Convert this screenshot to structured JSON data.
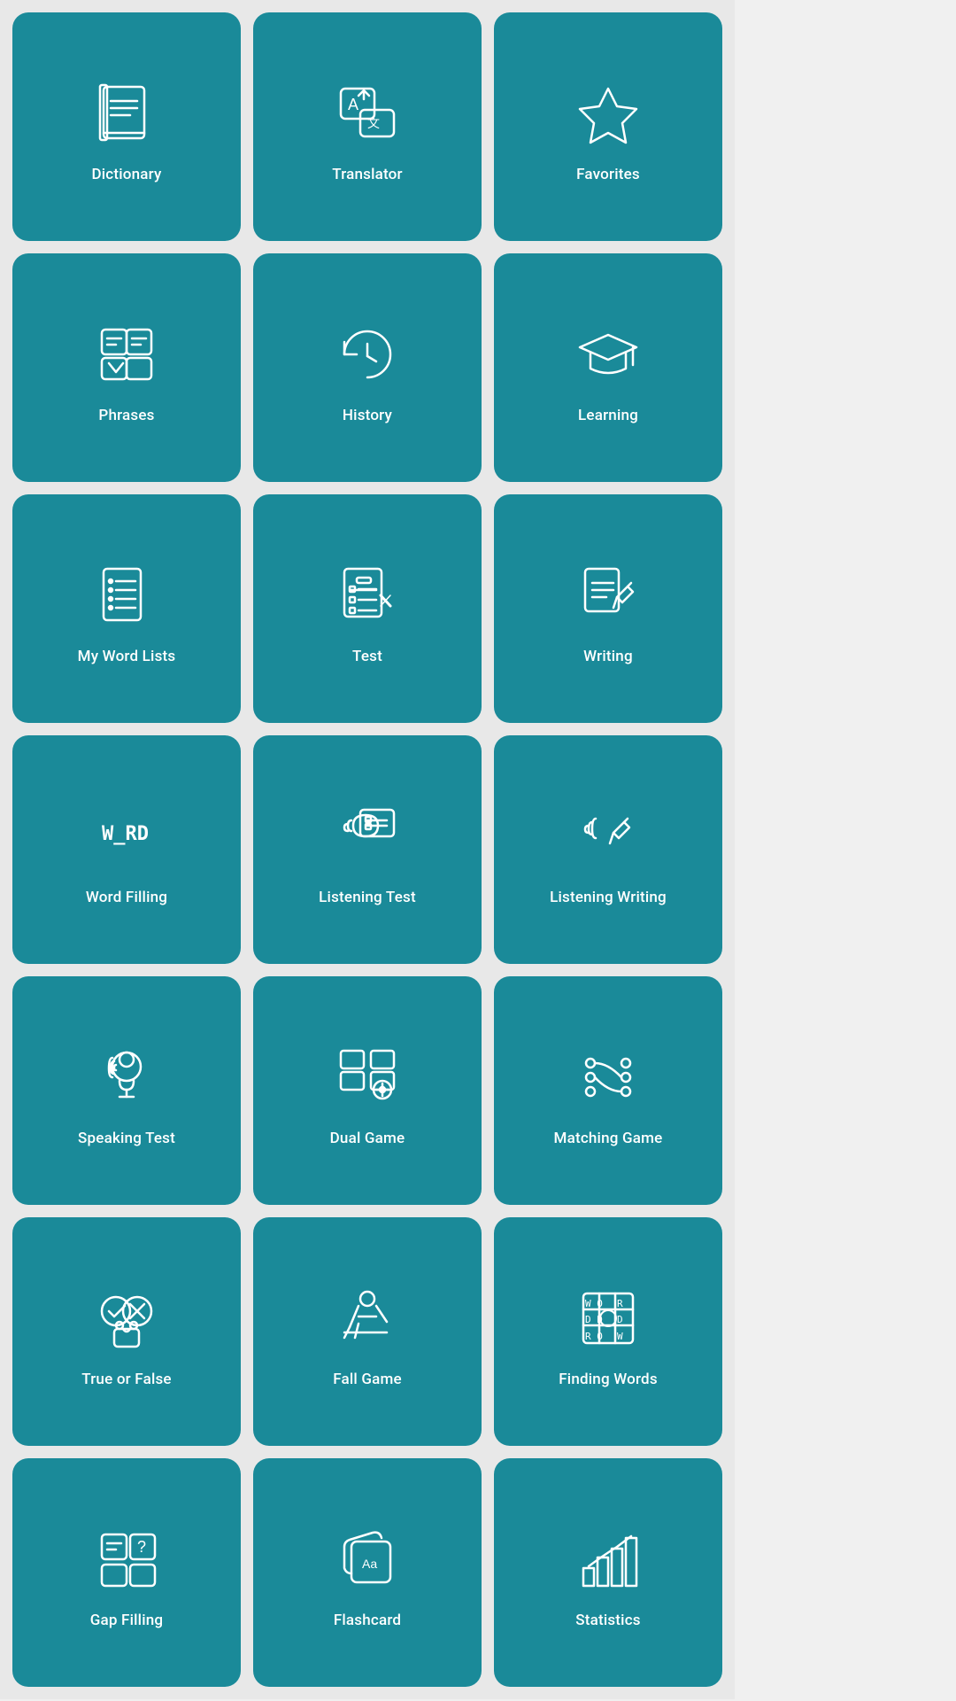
{
  "tiles": [
    {
      "id": "dictionary",
      "label": "Dictionary",
      "icon": "dictionary"
    },
    {
      "id": "translator",
      "label": "Translator",
      "icon": "translator"
    },
    {
      "id": "favorites",
      "label": "Favorites",
      "icon": "favorites"
    },
    {
      "id": "phrases",
      "label": "Phrases",
      "icon": "phrases"
    },
    {
      "id": "history",
      "label": "History",
      "icon": "history"
    },
    {
      "id": "learning",
      "label": "Learning",
      "icon": "learning"
    },
    {
      "id": "my-word-lists",
      "label": "My Word Lists",
      "icon": "wordlists"
    },
    {
      "id": "test",
      "label": "Test",
      "icon": "test"
    },
    {
      "id": "writing",
      "label": "Writing",
      "icon": "writing"
    },
    {
      "id": "word-filling",
      "label": "Word Filling",
      "icon": "wordfilling"
    },
    {
      "id": "listening-test",
      "label": "Listening Test",
      "icon": "listeningtest"
    },
    {
      "id": "listening-writing",
      "label": "Listening Writing",
      "icon": "listeningwriting"
    },
    {
      "id": "speaking-test",
      "label": "Speaking Test",
      "icon": "speakingtest"
    },
    {
      "id": "dual-game",
      "label": "Dual Game",
      "icon": "dualgame"
    },
    {
      "id": "matching-game",
      "label": "Matching Game",
      "icon": "matchinggame"
    },
    {
      "id": "true-or-false",
      "label": "True or False",
      "icon": "trueorfalse"
    },
    {
      "id": "fall-game",
      "label": "Fall Game",
      "icon": "fallgame"
    },
    {
      "id": "finding-words",
      "label": "Finding Words",
      "icon": "findingwords"
    },
    {
      "id": "gap-filling",
      "label": "Gap Filling",
      "icon": "gapfilling"
    },
    {
      "id": "flashcard",
      "label": "Flashcard",
      "icon": "flashcard"
    },
    {
      "id": "statistics",
      "label": "Statistics",
      "icon": "statistics"
    }
  ]
}
